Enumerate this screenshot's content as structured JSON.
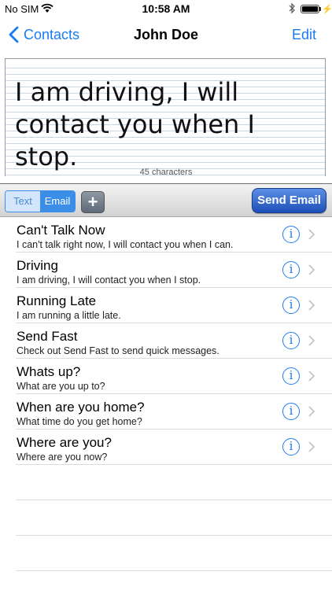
{
  "status_bar": {
    "carrier": "No SIM",
    "time": "10:58 AM"
  },
  "nav": {
    "back_label": "Contacts",
    "title": "John Doe",
    "edit_label": "Edit"
  },
  "message": {
    "text": "I am driving, I will contact you when I stop.",
    "char_count": "45 characters"
  },
  "toolbar": {
    "segments": [
      "Text",
      "Email"
    ],
    "selected_segment": "Email",
    "add_label": "+",
    "send_label": "Send Email"
  },
  "messages": [
    {
      "title": "Can't Talk Now",
      "body": "I can't talk right now, I will contact you when I can."
    },
    {
      "title": "Driving",
      "body": "I am driving, I will contact you when I stop."
    },
    {
      "title": "Running Late",
      "body": "I am running a little late."
    },
    {
      "title": "Send Fast",
      "body": "Check out Send Fast to send quick messages."
    },
    {
      "title": "Whats up?",
      "body": "What are you up to?"
    },
    {
      "title": "When are you home?",
      "body": "What time do you get home?"
    },
    {
      "title": "Where are you?",
      "body": "Where are you now?"
    }
  ],
  "colors": {
    "accent": "#1a7cf2",
    "send_button": "#2a5fc8"
  }
}
